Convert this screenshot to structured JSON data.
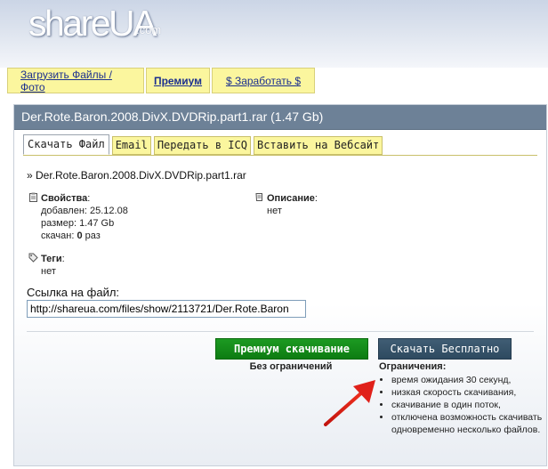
{
  "logo": {
    "main": "shareUA",
    "suffix": ".com"
  },
  "nav": [
    {
      "label": "Загрузить Файлы / Фото"
    },
    {
      "label": "Премиум"
    },
    {
      "label": "$ Заработать $"
    }
  ],
  "panel": {
    "title": "Der.Rote.Baron.2008.DivX.DVDRip.part1.rar (1.47 Gb)"
  },
  "tabs": [
    {
      "label": "Скачать Файл"
    },
    {
      "label": "Email"
    },
    {
      "label": "Передать в ICQ"
    },
    {
      "label": "Вставить на Вебсайт"
    }
  ],
  "file": {
    "name": "» Der.Rote.Baron.2008.DivX.DVDRip.part1.rar"
  },
  "props": {
    "title": "Свойства",
    "colon": ":",
    "added": "добавлен: 25.12.08",
    "size": "размер: 1.47 Gb",
    "downloaded_prefix": "скачан: ",
    "downloaded_count": "0",
    "downloaded_suffix": " раз"
  },
  "desc": {
    "title": "Описание",
    "colon": ":",
    "value": "нет"
  },
  "tags": {
    "title": "Теги",
    "colon": ":",
    "value": "нет"
  },
  "link": {
    "label": "Ссылка на файл:",
    "value": "http://shareua.com/files/show/2113721/Der.Rote.Baron"
  },
  "premium": {
    "button": "Премиум скачивание",
    "note": "Без ограничений"
  },
  "free": {
    "button": "Скачать Бесплатно"
  },
  "limits": {
    "title": "Ограничения:",
    "items": [
      "время ожидания 30 секунд,",
      "низкая скорость скачивания,",
      "скачивание в один поток,",
      "отключена возможность скачивать одновременно несколько файлов."
    ]
  },
  "colors": {
    "panel_header": "#6d8197",
    "nav_tab": "#fbf69e",
    "premium_button": "#129018",
    "free_button": "#3a566d",
    "arrow": "#e0201a"
  }
}
